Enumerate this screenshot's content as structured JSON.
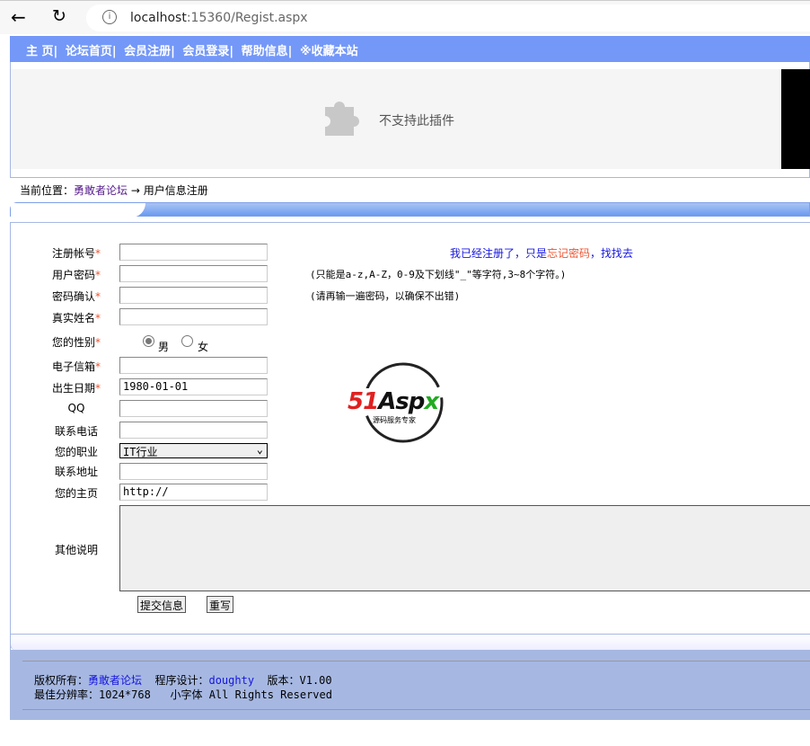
{
  "browser": {
    "url_host": "localhost",
    "url_rest": ":15360/Regist.aspx"
  },
  "nav": [
    "主  页|",
    "论坛首页|",
    "会员注册|",
    "会员登录|",
    "帮助信息|",
    "※收藏本站"
  ],
  "plugin": {
    "message": "不支持此插件"
  },
  "breadcrumb": {
    "prefix": "当前位置：",
    "link": "勇敢者论坛",
    "arrow": "→",
    "current": "用户信息注册"
  },
  "form": {
    "labels": {
      "account": "注册帐号",
      "password": "用户密码",
      "confirm": "密码确认",
      "realname": "真实姓名",
      "gender": "您的性别",
      "email": "电子信箱",
      "birth": "出生日期",
      "qq": "QQ",
      "phone": "联系电话",
      "job": "您的职业",
      "address": "联系地址",
      "homepage": "您的主页",
      "other": "其他说明"
    },
    "required_mark": "*",
    "gender_options": [
      "男",
      "女"
    ],
    "gender_selected": "男",
    "birth_value": "1980-01-01",
    "job_value": "IT行业",
    "homepage_value": "http://",
    "hint_registered": "我已经注册了，只是",
    "hint_forgot": "忘记密码",
    "hint_find": "，找找去",
    "password_hint": "(只能是a-z,A-Z，0-9及下划线\"_\"等字符,3~8个字符。)",
    "confirm_hint": "(请再输一遍密码，以确保不出错)",
    "submit": "提交信息",
    "reset": "重写"
  },
  "logo": {
    "text": "51Aspx",
    "sub": "源码服务专家"
  },
  "footer": {
    "copyright": "版权所有：",
    "site": "勇敢者论坛",
    "design": "  程序设计：",
    "designer": "doughty",
    "version": "  版本：V1.00",
    "line2": "最佳分辨率：1024*768   小字体 All Rights Reserved"
  },
  "colors": {
    "nav": "#7498f8",
    "footer": "#a6b8e2",
    "required": "#e53",
    "link": "#1515e0"
  }
}
